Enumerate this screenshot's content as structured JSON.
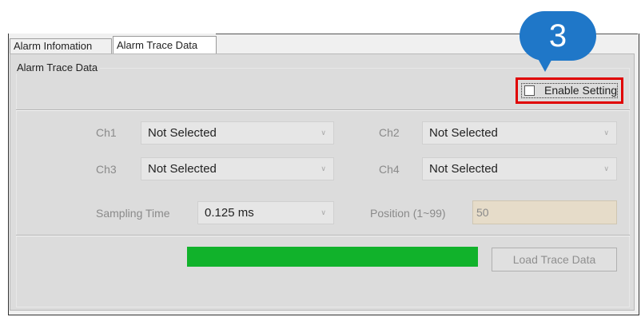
{
  "tabs": [
    {
      "label": "Alarm Infomation",
      "active": false
    },
    {
      "label": "Alarm Trace Data",
      "active": true
    }
  ],
  "group": {
    "title": "Alarm Trace Data"
  },
  "enable_setting": {
    "label": "Enable Setting",
    "checked": false
  },
  "callout": {
    "number": "3",
    "color": "#1f77c8"
  },
  "channels": [
    {
      "label": "Ch1",
      "value": "Not Selected"
    },
    {
      "label": "Ch2",
      "value": "Not Selected"
    },
    {
      "label": "Ch3",
      "value": "Not Selected"
    },
    {
      "label": "Ch4",
      "value": "Not Selected"
    }
  ],
  "sampling_time": {
    "label": "Sampling Time",
    "value": "0.125 ms"
  },
  "position": {
    "label": "Position (1~99)",
    "value": "50"
  },
  "progress": {
    "fraction": 1.0,
    "color": "#11b22b"
  },
  "load_button": {
    "label": "Load Trace Data"
  },
  "icons": {
    "dropdown": "chevron-down-icon",
    "checkbox": "checkbox-icon"
  }
}
